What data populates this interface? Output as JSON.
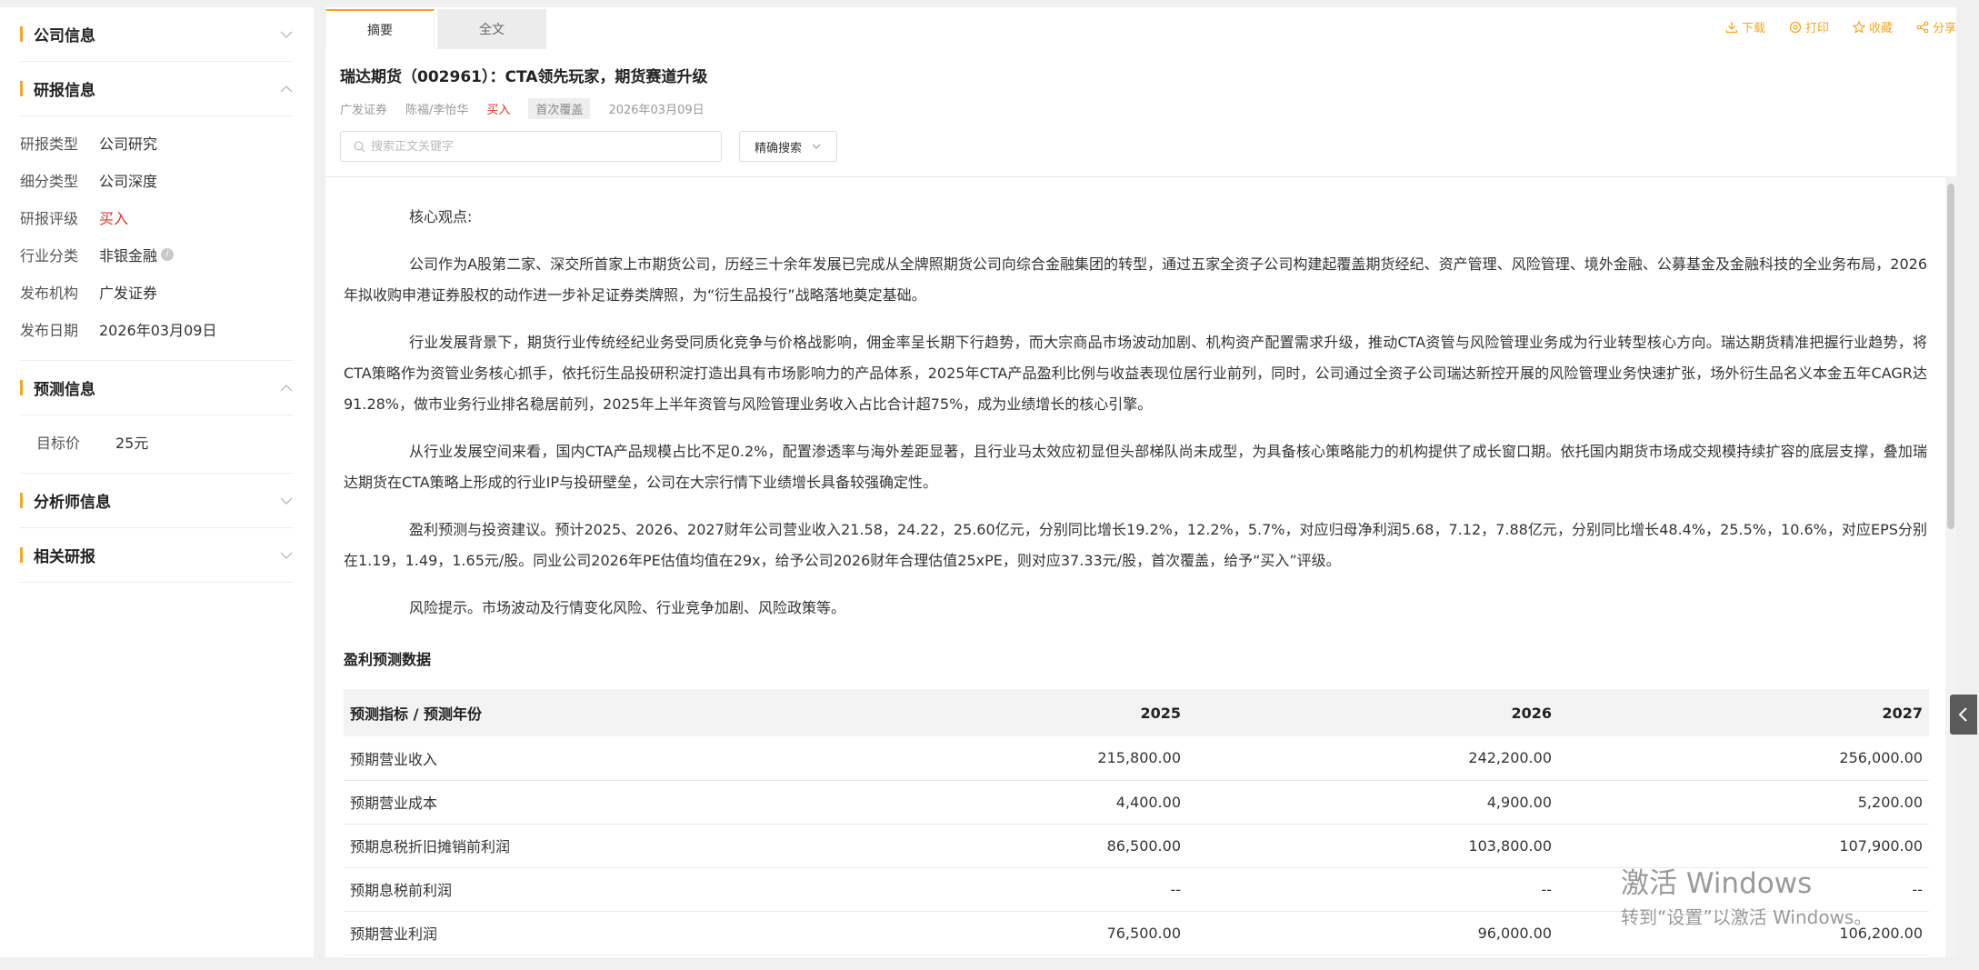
{
  "sidebar": {
    "company_info": {
      "title": "公司信息"
    },
    "report_info": {
      "title": "研报信息",
      "rows": [
        {
          "key": "研报类型",
          "value": "公司研究"
        },
        {
          "key": "细分类型",
          "value": "公司深度"
        },
        {
          "key": "研报评级",
          "value": "买入"
        },
        {
          "key": "行业分类",
          "value": "非银金融"
        },
        {
          "key": "发布机构",
          "value": "广发证券"
        },
        {
          "key": "发布日期",
          "value": "2026年03月09日"
        }
      ]
    },
    "forecast_info": {
      "title": "预测信息",
      "rows": [
        {
          "key": "目标价",
          "value": "25元"
        }
      ]
    },
    "analyst_info": {
      "title": "分析师信息"
    },
    "related": {
      "title": "相关研报"
    }
  },
  "tabs": [
    {
      "label": "摘要"
    },
    {
      "label": "全文"
    }
  ],
  "actions": {
    "download": "下载",
    "print": "打印",
    "favorite": "收藏",
    "share": "分享"
  },
  "report": {
    "title": "瑞达期货（002961）：CTA领先玩家，期货赛道升级",
    "broker": "广发证券",
    "authors": "陈福/李怡华",
    "rating": "买入",
    "tag": "首次覆盖",
    "date": "2026年03月09日"
  },
  "search": {
    "placeholder": "搜索正文关键字",
    "mode": "精确搜索"
  },
  "paragraphs": [
    "核心观点:",
    "公司作为A股第二家、深交所首家上市期货公司，历经三十余年发展已完成从全牌照期货公司向综合金融集团的转型，通过五家全资子公司构建起覆盖期货经纪、资产管理、风险管理、境外金融、公募基金及金融科技的全业务布局，2026年拟收购申港证券股权的动作进一步补足证券类牌照，为“衍生品投行”战略落地奠定基础。",
    "行业发展背景下，期货行业传统经纪业务受同质化竞争与价格战影响，佣金率呈长期下行趋势，而大宗商品市场波动加剧、机构资产配置需求升级，推动CTA资管与风险管理业务成为行业转型核心方向。瑞达期货精准把握行业趋势，将CTA策略作为资管业务核心抓手，依托衍生品投研积淀打造出具有市场影响力的产品体系，2025年CTA产品盈利比例与收益表现位居行业前列，同时，公司通过全资子公司瑞达新控开展的风险管理业务快速扩张，场外衍生品名义本金五年CAGR达91.28%，做市业务行业排名稳居前列，2025年上半年资管与风险管理业务收入占比合计超75%，成为业绩增长的核心引擎。",
    "从行业发展空间来看，国内CTA产品规模占比不足0.2%，配置渗透率与海外差距显著，且行业马太效应初显但头部梯队尚未成型，为具备核心策略能力的机构提供了成长窗口期。依托国内期货市场成交规模持续扩容的底层支撑，叠加瑞达期货在CTA策略上形成的行业IP与投研壁垒，公司在大宗行情下业绩增长具备较强确定性。",
    "盈利预测与投资建议。预计2025、2026、2027财年公司营业收入21.58，24.22，25.60亿元，分别同比增长19.2%，12.2%，5.7%，对应归母净利润5.68，7.12，7.88亿元，分别同比增长48.4%，25.5%，10.6%，对应EPS分别在1.19，1.49，1.65元/股。同业公司2026年PE估值均值在29x，给予公司2026财年合理估值25xPE，则对应37.33元/股，首次覆盖，给予“买入”评级。",
    "风险提示。市场波动及行情变化风险、行业竞争加剧、风险政策等。"
  ],
  "forecast_table": {
    "title": "盈利预测数据",
    "headers": [
      "预测指标 / 预测年份",
      "2025",
      "2026",
      "2027"
    ],
    "rows": [
      [
        "预期营业收入",
        "215,800.00",
        "242,200.00",
        "256,000.00"
      ],
      [
        "预期营业成本",
        "4,400.00",
        "4,900.00",
        "5,200.00"
      ],
      [
        "预期息税折旧摊销前利润",
        "86,500.00",
        "103,800.00",
        "107,900.00"
      ],
      [
        "预期息税前利润",
        "--",
        "--",
        "--"
      ],
      [
        "预期营业利润",
        "76,500.00",
        "96,000.00",
        "106,200.00"
      ]
    ]
  },
  "watermark": {
    "line1": "激活 Windows",
    "line2": "转到“设置”以激活 Windows。"
  },
  "colors": {
    "accent": "#f5a623",
    "rating_red": "#e0302a"
  }
}
